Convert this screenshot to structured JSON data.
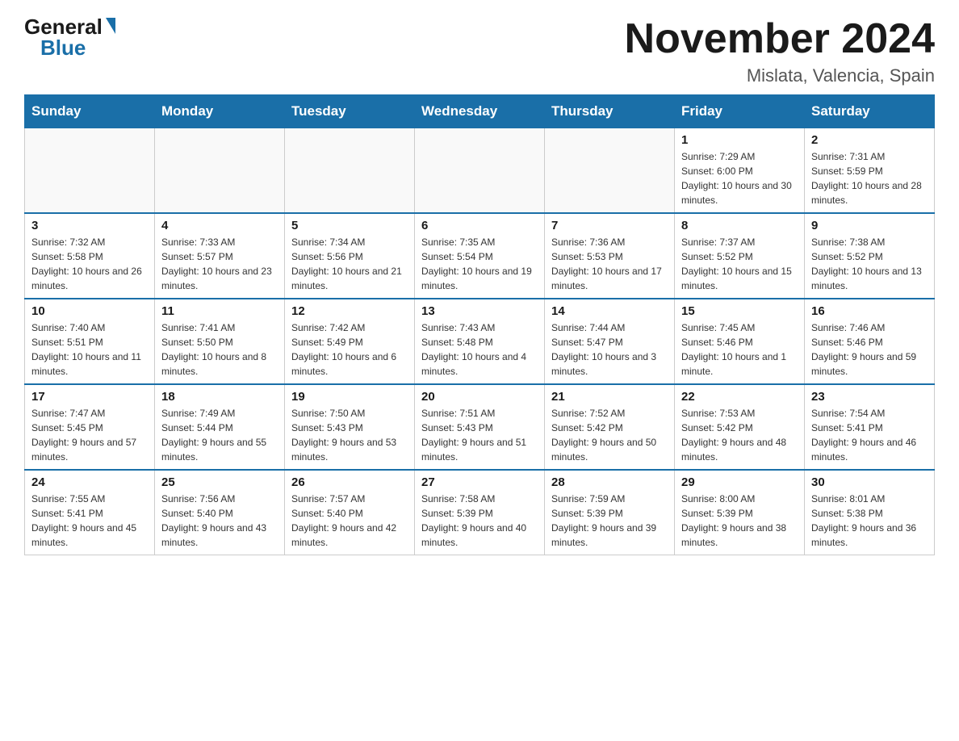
{
  "header": {
    "logo_general": "General",
    "logo_blue": "Blue",
    "title": "November 2024",
    "subtitle": "Mislata, Valencia, Spain"
  },
  "days_of_week": [
    "Sunday",
    "Monday",
    "Tuesday",
    "Wednesday",
    "Thursday",
    "Friday",
    "Saturday"
  ],
  "weeks": [
    [
      {
        "day": "",
        "info": ""
      },
      {
        "day": "",
        "info": ""
      },
      {
        "day": "",
        "info": ""
      },
      {
        "day": "",
        "info": ""
      },
      {
        "day": "",
        "info": ""
      },
      {
        "day": "1",
        "info": "Sunrise: 7:29 AM\nSunset: 6:00 PM\nDaylight: 10 hours and 30 minutes."
      },
      {
        "day": "2",
        "info": "Sunrise: 7:31 AM\nSunset: 5:59 PM\nDaylight: 10 hours and 28 minutes."
      }
    ],
    [
      {
        "day": "3",
        "info": "Sunrise: 7:32 AM\nSunset: 5:58 PM\nDaylight: 10 hours and 26 minutes."
      },
      {
        "day": "4",
        "info": "Sunrise: 7:33 AM\nSunset: 5:57 PM\nDaylight: 10 hours and 23 minutes."
      },
      {
        "day": "5",
        "info": "Sunrise: 7:34 AM\nSunset: 5:56 PM\nDaylight: 10 hours and 21 minutes."
      },
      {
        "day": "6",
        "info": "Sunrise: 7:35 AM\nSunset: 5:54 PM\nDaylight: 10 hours and 19 minutes."
      },
      {
        "day": "7",
        "info": "Sunrise: 7:36 AM\nSunset: 5:53 PM\nDaylight: 10 hours and 17 minutes."
      },
      {
        "day": "8",
        "info": "Sunrise: 7:37 AM\nSunset: 5:52 PM\nDaylight: 10 hours and 15 minutes."
      },
      {
        "day": "9",
        "info": "Sunrise: 7:38 AM\nSunset: 5:52 PM\nDaylight: 10 hours and 13 minutes."
      }
    ],
    [
      {
        "day": "10",
        "info": "Sunrise: 7:40 AM\nSunset: 5:51 PM\nDaylight: 10 hours and 11 minutes."
      },
      {
        "day": "11",
        "info": "Sunrise: 7:41 AM\nSunset: 5:50 PM\nDaylight: 10 hours and 8 minutes."
      },
      {
        "day": "12",
        "info": "Sunrise: 7:42 AM\nSunset: 5:49 PM\nDaylight: 10 hours and 6 minutes."
      },
      {
        "day": "13",
        "info": "Sunrise: 7:43 AM\nSunset: 5:48 PM\nDaylight: 10 hours and 4 minutes."
      },
      {
        "day": "14",
        "info": "Sunrise: 7:44 AM\nSunset: 5:47 PM\nDaylight: 10 hours and 3 minutes."
      },
      {
        "day": "15",
        "info": "Sunrise: 7:45 AM\nSunset: 5:46 PM\nDaylight: 10 hours and 1 minute."
      },
      {
        "day": "16",
        "info": "Sunrise: 7:46 AM\nSunset: 5:46 PM\nDaylight: 9 hours and 59 minutes."
      }
    ],
    [
      {
        "day": "17",
        "info": "Sunrise: 7:47 AM\nSunset: 5:45 PM\nDaylight: 9 hours and 57 minutes."
      },
      {
        "day": "18",
        "info": "Sunrise: 7:49 AM\nSunset: 5:44 PM\nDaylight: 9 hours and 55 minutes."
      },
      {
        "day": "19",
        "info": "Sunrise: 7:50 AM\nSunset: 5:43 PM\nDaylight: 9 hours and 53 minutes."
      },
      {
        "day": "20",
        "info": "Sunrise: 7:51 AM\nSunset: 5:43 PM\nDaylight: 9 hours and 51 minutes."
      },
      {
        "day": "21",
        "info": "Sunrise: 7:52 AM\nSunset: 5:42 PM\nDaylight: 9 hours and 50 minutes."
      },
      {
        "day": "22",
        "info": "Sunrise: 7:53 AM\nSunset: 5:42 PM\nDaylight: 9 hours and 48 minutes."
      },
      {
        "day": "23",
        "info": "Sunrise: 7:54 AM\nSunset: 5:41 PM\nDaylight: 9 hours and 46 minutes."
      }
    ],
    [
      {
        "day": "24",
        "info": "Sunrise: 7:55 AM\nSunset: 5:41 PM\nDaylight: 9 hours and 45 minutes."
      },
      {
        "day": "25",
        "info": "Sunrise: 7:56 AM\nSunset: 5:40 PM\nDaylight: 9 hours and 43 minutes."
      },
      {
        "day": "26",
        "info": "Sunrise: 7:57 AM\nSunset: 5:40 PM\nDaylight: 9 hours and 42 minutes."
      },
      {
        "day": "27",
        "info": "Sunrise: 7:58 AM\nSunset: 5:39 PM\nDaylight: 9 hours and 40 minutes."
      },
      {
        "day": "28",
        "info": "Sunrise: 7:59 AM\nSunset: 5:39 PM\nDaylight: 9 hours and 39 minutes."
      },
      {
        "day": "29",
        "info": "Sunrise: 8:00 AM\nSunset: 5:39 PM\nDaylight: 9 hours and 38 minutes."
      },
      {
        "day": "30",
        "info": "Sunrise: 8:01 AM\nSunset: 5:38 PM\nDaylight: 9 hours and 36 minutes."
      }
    ]
  ]
}
